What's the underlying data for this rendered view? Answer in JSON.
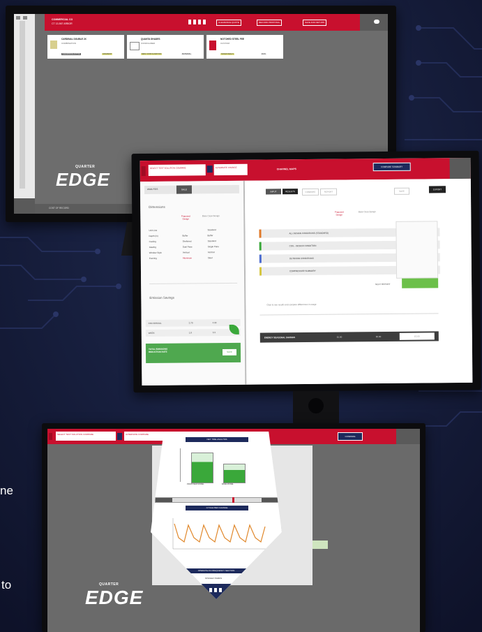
{
  "brand": {
    "logo_top_small": "QUARTER",
    "logo_word": "EDGE",
    "logo_bottom_small": "QUARTER"
  },
  "monitor1": {
    "header_line1": "COMMERCIAL CO",
    "header_line2": "CT 13-567 ARBOR",
    "buttons": [
      "CLEARANCE QUOTE",
      "RECORD PROPOSAL",
      "SAVE AND RETURN"
    ],
    "cards": [
      {
        "title": "CARDINAL DOUBLE 2X",
        "sub": "COMBINATION",
        "tag1": "CLEARANCE ACTIVE",
        "tag2": "GRADIENT"
      },
      {
        "title": "QUANTA SHADES",
        "sub": "CONFIGURED",
        "tag1": "NEW CONFIGURATION",
        "tag2": "MATERIAL"
      },
      {
        "title": "NOTCHED STEEL FEE",
        "sub": "CUSTOM",
        "tag1": "SAVED DEALS",
        "tag2": "RUN"
      }
    ],
    "footer_left": "COST OF RECORD"
  },
  "monitor2": {
    "tab_active": "SELECT TEST SOLUTION COMPARE",
    "tab2": "ALTERNATE CHANGE",
    "center_title": "CHANNEL MAPS",
    "right_button": "COMPARE SUMMARY",
    "left_tabs": [
      "ANALYSIS",
      "SALE"
    ],
    "left_section": "Dimensions",
    "col_a": "Proposed Design",
    "col_b": "Base Case Design",
    "rows": [
      {
        "label": "Unit Line",
        "a": "",
        "b": "Standard"
      },
      {
        "label": "Depth (in)",
        "a": "Buffer",
        "b": "Buffer"
      },
      {
        "label": "Cooling",
        "a": "Sheltered",
        "b": "Standard"
      },
      {
        "label": "Glazing",
        "a": "Dual Pane",
        "b": "Single Pane"
      },
      {
        "label": "Window Style",
        "a": "Vertical",
        "b": "Vertical"
      },
      {
        "label": "Framing",
        "a": "Aluminum",
        "b": "Steel"
      }
    ],
    "emission_section": "Emission Savings",
    "emission_rows": [
      {
        "label": "CO2 ANNUAL",
        "a": "2.70",
        "b": "4.93"
      },
      {
        "label": "WEEK",
        "a": "1.8",
        "b": "3.3"
      }
    ],
    "emission_total": "TOTAL EMISSIONS REDUCTION RATE",
    "emission_button": "SAVE",
    "right_tabs": [
      "INPUT",
      "RESULTS",
      "COMPARE",
      "REPORT"
    ],
    "right_top_buttons": [
      "SAVE",
      "EXPORT"
    ],
    "right_header_a": "Proposed Design",
    "right_header_b": "Base Case Design",
    "right_rows": [
      "ALL DESIGN CONDITIONS (STANDARD)",
      "COIL - DESIGN CONDITION",
      "OUTDOOR CONDITIONS",
      "COMPRESSOR SUMMARY"
    ],
    "right_total": "NEXT REPORT",
    "note": "Click to see results and compare differences in usage",
    "bottom_label": "ENERGY SEASONAL SAVINGS",
    "bottom_a": "$1.00",
    "bottom_b": "$2.00",
    "bottom_c": "$3.00"
  },
  "monitor3": {
    "tab_active": "SELECT TEST SOLUTION COMPARE",
    "tab2": "ALTERNATE COMPARE",
    "right_button": "COMPARE",
    "popup_title": "NET TIME ANALYSIS",
    "popup_section2": "CYCLE PER CHANGE",
    "popup_bottom": "OPERATE AS FREQUENCY SECTION",
    "popup_user": "STANLEY PARKS",
    "bar_label_a": "PROPOSED MODEL",
    "bar_label_b": "BASE MODEL"
  },
  "side_text": [
    "ne",
    "to"
  ],
  "colors": {
    "brand_red": "#c8102e",
    "accent_green": "#3aa83a",
    "navy": "#1d2a5c"
  }
}
